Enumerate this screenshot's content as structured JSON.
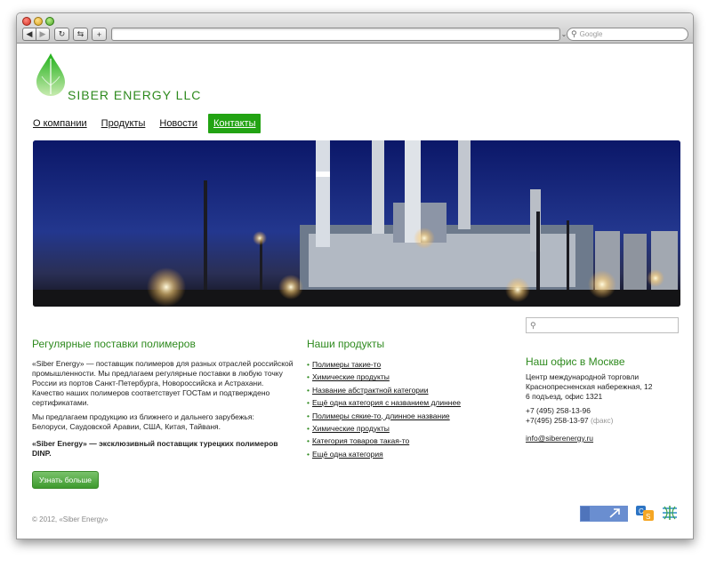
{
  "browser": {
    "search_placeholder": "Google",
    "icons": [
      "back-arrow-icon",
      "forward-arrow-icon",
      "reload-icon",
      "share-icon",
      "plus-icon",
      "rss-icon",
      "search-icon"
    ]
  },
  "logo": {
    "text": "SIBER ENERGY LLC",
    "colors": {
      "drop_top": "#1fb018",
      "drop_bottom": "#c8ebb0",
      "text": "#2e8a1e"
    }
  },
  "nav": {
    "items": [
      {
        "label": "О компании",
        "active": false
      },
      {
        "label": "Продукты",
        "active": false
      },
      {
        "label": "Новости",
        "active": false
      },
      {
        "label": "Контакты",
        "active": true
      }
    ],
    "active_color": "#22a313"
  },
  "left": {
    "title": "Регулярные поставки полимеров",
    "para1": [
      "«Siber Energy» — поставщик полимеров для разных отраслей российской",
      "промышленности. Мы предлагаем регулярные поставки в любую точку",
      "России из портов Санкт-Петербурга, Новороссийска и Астрахани.",
      "Качество наших полимеров соответствует ГОСТам и подтверждено",
      "сертификатами."
    ],
    "para2": [
      "Мы предлагаем продукцию из ближнего и дальнего зарубежья:",
      "Белоруси, Саудовской Аравии, США, Китая, Тайваня."
    ],
    "para3_bold": [
      "«Siber Energy» — эксклюзивный поставщик турецких полимеров",
      "DINP."
    ],
    "button": "Узнать больше"
  },
  "products": {
    "title": "Наши продукты",
    "items": [
      "Полимеры такие-то",
      "Химические продукты",
      "Название абстрактной категории",
      "Ещё одна категория с названием длиннее",
      "Полимеры сякие-то, длинное название",
      "Химические продукты",
      "Категория товаров такая-то",
      "Ещё одна категория"
    ]
  },
  "office": {
    "title": "Наш офис в Москве",
    "address": [
      "Центр международной торговли",
      "Краснопресненская набережная, 12",
      "6 подъезд, офис 1321"
    ],
    "phone1": "+7 (495) 258-13-96",
    "phone2": "+7(495) 258-13-97",
    "fax_label": "(факс)",
    "email": "info@siberenergy.ru"
  },
  "footer": {
    "copyright": "© 2012, «Siber Energy»"
  }
}
